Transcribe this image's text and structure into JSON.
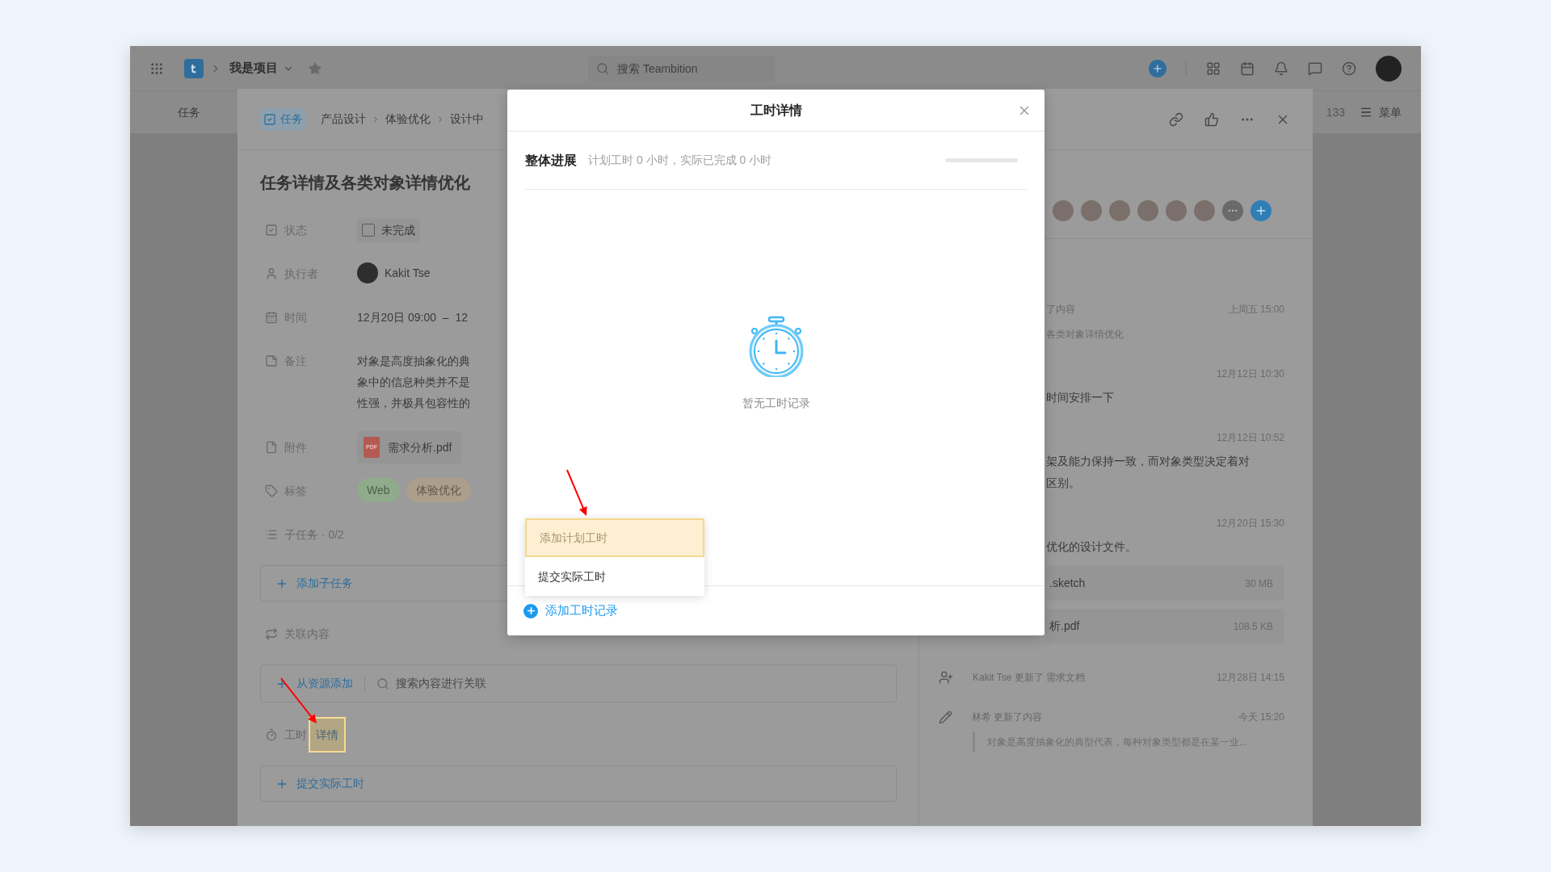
{
  "top_bar": {
    "project": "我是项目",
    "search": {
      "placeholder": "搜索 Teambition"
    }
  },
  "nav": {
    "tab": "任务",
    "count": "133",
    "menu": "菜单"
  },
  "task": {
    "type_badge": "任务",
    "breadcrumb": [
      "产品设计",
      "体验优化",
      "设计中"
    ],
    "title": "任务详情及各类对象详情优化",
    "fields": [
      {
        "kind": "status",
        "label": "状态",
        "value": "未完成",
        "checked": false
      },
      {
        "kind": "assignee",
        "label": "执行者",
        "value": "Kakit Tse"
      },
      {
        "kind": "time",
        "label": "时间",
        "value": "12月20日 09:00  –  12"
      },
      {
        "kind": "note",
        "label": "备注",
        "lines": [
          "对象是高度抽象化的典",
          "象中的信息种类并不是",
          "性强，并极具包容性的"
        ]
      },
      {
        "kind": "attachment",
        "label": "附件",
        "value": "需求分析.pdf",
        "icon_label": "PDF"
      },
      {
        "kind": "tags",
        "label": "标签",
        "tags": [
          {
            "text": "Web",
            "color": "#8fab8c"
          },
          {
            "text": "体验优化",
            "color": "#ad9e8b"
          }
        ]
      }
    ],
    "subtasks": {
      "label": "子任务 · 0/2",
      "add": "添加子任务"
    },
    "related": {
      "label": "关联内容",
      "add": "从资源添加",
      "search_placeholder": "搜索内容进行关联"
    },
    "time_tracking": {
      "label": "工时",
      "link": "详情",
      "highlighted": true,
      "submit": "提交实际工时"
    }
  },
  "activity": [
    {
      "kind": "comment",
      "text": [
        "了内容"
      ],
      "time": "上周五 15:00",
      "detail": "各类对象详情优化"
    },
    {
      "kind": "comment",
      "time": "12月12日 10:30",
      "text": [
        "时间安排一下"
      ]
    },
    {
      "kind": "comment",
      "time": "12月12日 10:52",
      "text": [
        "架及能力保持一致，而对象类型决定着对",
        "区别。"
      ]
    },
    {
      "kind": "comment",
      "time": "12月20日 15:30",
      "text": [
        "优化的设计文件。"
      ],
      "files": [
        {
          "name": ".sketch",
          "size": "30 MB"
        },
        {
          "name": "析.pdf",
          "size": "108.5 KB"
        }
      ]
    },
    {
      "kind": "member_log",
      "time": "12月28日 14:15",
      "text": [
        "Kakit Tse 更新了 需求文档"
      ]
    },
    {
      "kind": "edit_log",
      "time": "今天 15:20",
      "text": [
        "林希 更新了内容"
      ],
      "quote": "对象是高度抽象化的典型代表，每种对象类型都是在某一业..."
    }
  ],
  "modal": {
    "title": "工时详情",
    "progress": {
      "label": "整体进展",
      "summary": "计划工时 0 小时，实际已完成 0 小时",
      "level": 0
    },
    "empty": "暂无工时记录",
    "menu": [
      {
        "label": "添加计划工时",
        "highlighted": true
      },
      {
        "label": "提交实际工时",
        "highlighted": false
      }
    ],
    "add": "添加工时记录"
  }
}
